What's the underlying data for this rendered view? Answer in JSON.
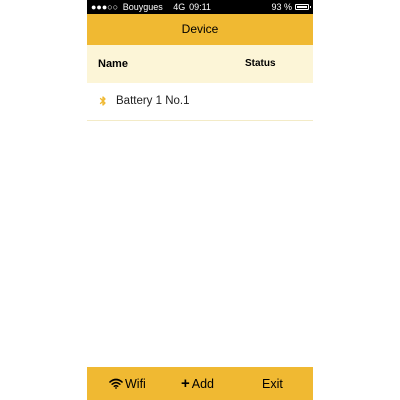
{
  "status_bar": {
    "signal": "●●●○○",
    "carrier": "Bouygues",
    "network": "4G",
    "time": "09:11",
    "battery": "93 %",
    "battery_level": 0.93
  },
  "header": {
    "title": "Device"
  },
  "table": {
    "columns": {
      "name": "Name",
      "status": "Status"
    },
    "rows": [
      {
        "icon": "bluetooth-icon",
        "name": "Battery 1 No.1",
        "status": ""
      }
    ]
  },
  "toolbar": {
    "wifi_label": "Wifi",
    "add_label": "Add",
    "exit_label": "Exit"
  },
  "colors": {
    "accent": "#f0b932",
    "header_row": "#fcf5d7"
  }
}
